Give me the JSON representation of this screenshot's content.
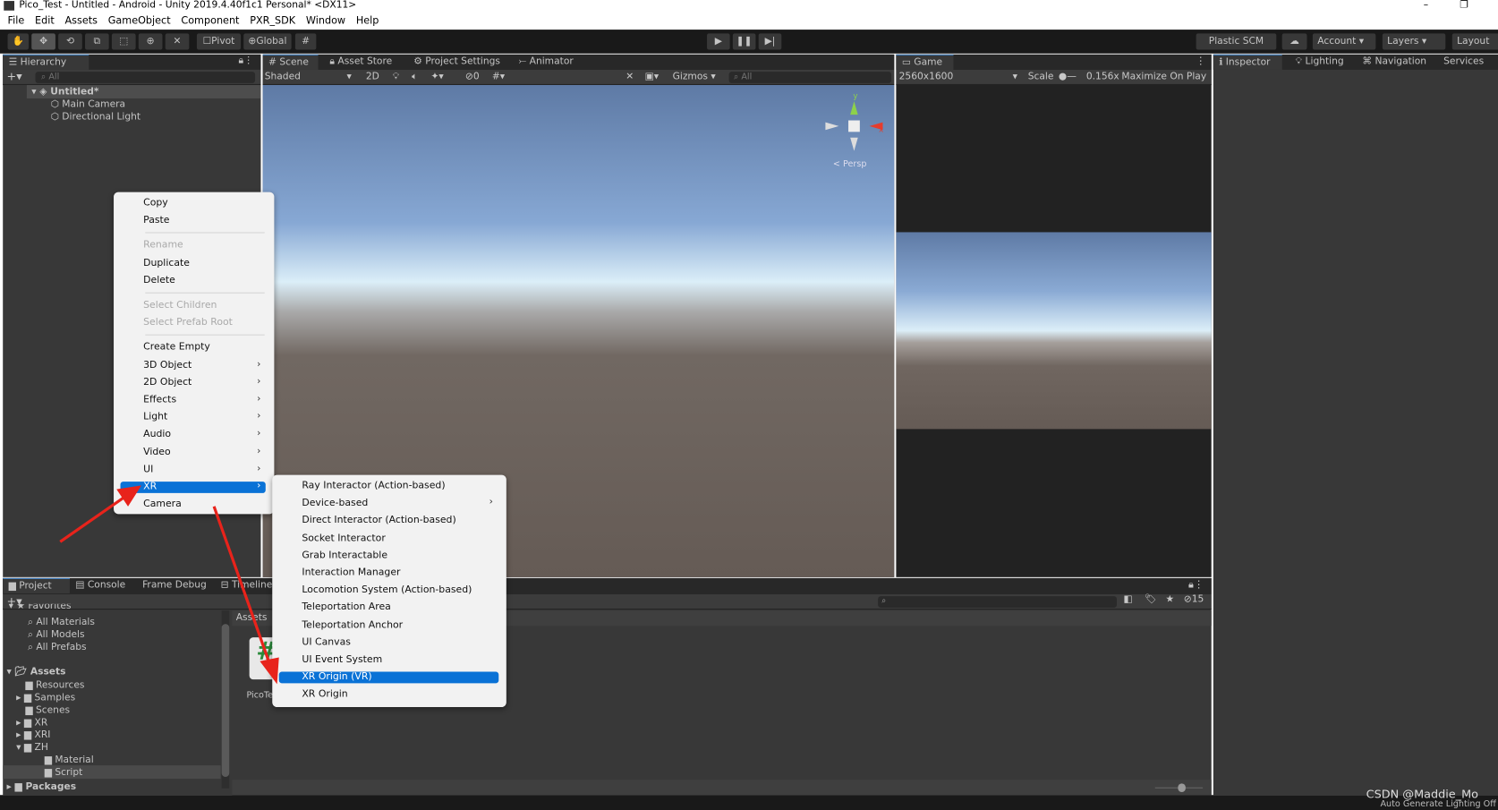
{
  "window": {
    "title": "Pico_Test - Untitled - Android - Unity 2019.4.40f1c1 Personal* <DX11>",
    "minimize": "–",
    "restore": "❐"
  },
  "menubar": [
    "File",
    "Edit",
    "Assets",
    "GameObject",
    "Component",
    "PXR_SDK",
    "Window",
    "Help"
  ],
  "toolbar": {
    "pivot": "Pivot",
    "global": "Global",
    "plastic": "Plastic SCM",
    "account": "Account",
    "layers": "Layers",
    "layout": "Layout"
  },
  "hierarchy": {
    "tab": "Hierarchy",
    "search_placeholder": "All",
    "scene": "Untitled*",
    "items": [
      "Main Camera",
      "Directional Light"
    ]
  },
  "scene": {
    "tabs": [
      "Scene",
      "Asset Store",
      "Project Settings",
      "Animator"
    ],
    "shading": "Shaded",
    "mode2d": "2D",
    "hidden_count": "0",
    "gizmos": "Gizmos",
    "search_placeholder": "All",
    "persp": "Persp",
    "axis_x": "x",
    "axis_y": "y"
  },
  "game": {
    "tab": "Game",
    "resolution": "2560x1600",
    "scale_label": "Scale",
    "scale_value": "0.156x",
    "maximize": "Maximize On Play"
  },
  "inspector": {
    "tabs": [
      "Inspector",
      "Lighting",
      "Navigation",
      "Services"
    ]
  },
  "context_menu": {
    "items": [
      {
        "label": "Copy"
      },
      {
        "label": "Paste"
      },
      {
        "sep": true
      },
      {
        "label": "Rename",
        "disabled": true
      },
      {
        "label": "Duplicate"
      },
      {
        "label": "Delete"
      },
      {
        "sep": true
      },
      {
        "label": "Select Children",
        "disabled": true
      },
      {
        "label": "Select Prefab Root",
        "disabled": true
      },
      {
        "sep": true
      },
      {
        "label": "Create Empty"
      },
      {
        "label": "3D Object",
        "sub": true
      },
      {
        "label": "2D Object",
        "sub": true
      },
      {
        "label": "Effects",
        "sub": true
      },
      {
        "label": "Light",
        "sub": true
      },
      {
        "label": "Audio",
        "sub": true
      },
      {
        "label": "Video",
        "sub": true
      },
      {
        "label": "UI",
        "sub": true
      },
      {
        "label": "XR",
        "sub": true,
        "selected": true
      },
      {
        "label": "Camera"
      }
    ]
  },
  "xr_submenu": {
    "items": [
      {
        "label": "Ray Interactor (Action-based)"
      },
      {
        "label": "Device-based",
        "sub": true
      },
      {
        "label": "Direct Interactor (Action-based)"
      },
      {
        "label": "Socket Interactor"
      },
      {
        "label": "Grab Interactable"
      },
      {
        "label": "Interaction Manager"
      },
      {
        "label": "Locomotion System (Action-based)"
      },
      {
        "label": "Teleportation Area"
      },
      {
        "label": "Teleportation Anchor"
      },
      {
        "label": "UI Canvas"
      },
      {
        "label": "UI Event System"
      },
      {
        "label": "XR Origin (VR)",
        "selected": true
      },
      {
        "label": "XR Origin"
      }
    ]
  },
  "project": {
    "tabs": [
      "Project",
      "Console",
      "Frame Debug",
      "Timeline"
    ],
    "favorites": "Favorites",
    "favorite_items": [
      "All Materials",
      "All Models",
      "All Prefabs"
    ],
    "assets_root": "Assets",
    "tree": [
      {
        "label": "Resources",
        "depth": 1
      },
      {
        "label": "Samples",
        "depth": 1
      },
      {
        "label": "Scenes",
        "depth": 1
      },
      {
        "label": "XR",
        "depth": 1
      },
      {
        "label": "XRI",
        "depth": 1
      },
      {
        "label": "ZH",
        "depth": 1
      },
      {
        "label": "Material",
        "depth": 2
      },
      {
        "label": "Script",
        "depth": 2,
        "selected": true
      }
    ],
    "packages": "Packages",
    "breadcrumb": "Assets",
    "asset_name": "PicoTe",
    "hidden_count": "15"
  },
  "status": {
    "lighting": "Auto Generate Lighting Off",
    "watermark": "CSDN @Maddie_Mo"
  },
  "colors": {
    "accent": "#0a72d6",
    "arrow": "#e8231b"
  }
}
